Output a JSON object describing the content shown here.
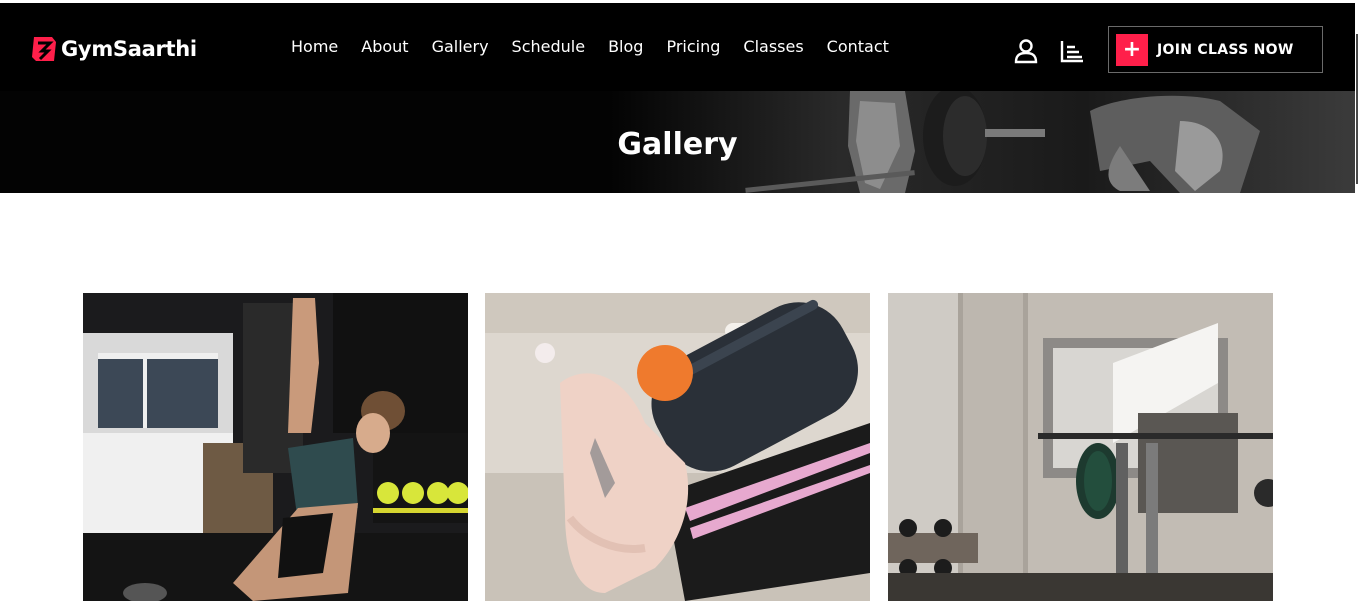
{
  "brand": {
    "name": "GymSaarthi",
    "accent": "#ff1f4a"
  },
  "nav": {
    "items": [
      {
        "label": "Home"
      },
      {
        "label": "About"
      },
      {
        "label": "Gallery"
      },
      {
        "label": "Schedule"
      },
      {
        "label": "Blog"
      },
      {
        "label": "Pricing"
      },
      {
        "label": "Classes"
      },
      {
        "label": "Contact"
      }
    ]
  },
  "actions": {
    "user_icon": "user-icon",
    "chart_icon": "chart-icon",
    "join_label": "JOIN CLASS NOW",
    "join_plus": "+"
  },
  "hero": {
    "title": "Gallery"
  },
  "gallery": {
    "images": [
      {
        "name": "yoga-stretch-photo"
      },
      {
        "name": "shoe-bottle-photo"
      },
      {
        "name": "gym-equipment-photo"
      }
    ]
  }
}
